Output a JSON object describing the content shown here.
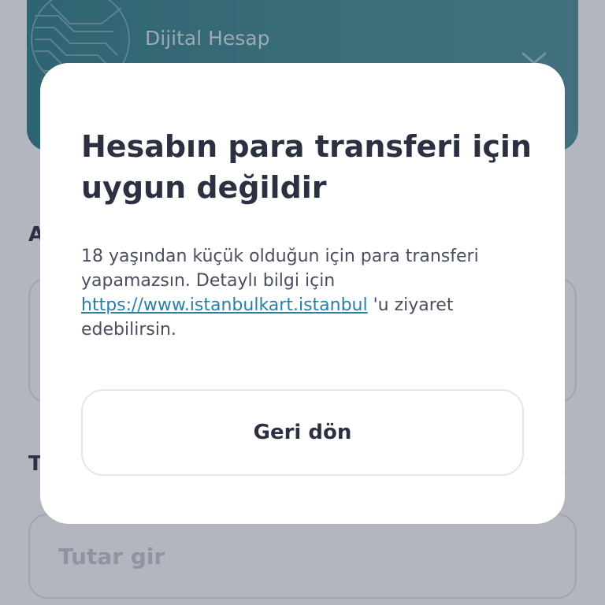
{
  "card": {
    "label": "Dijital Hesap"
  },
  "background": {
    "section_a_heading": "A",
    "section_t_heading": "T",
    "section_t_link": ")",
    "amount_input": {
      "value": "",
      "placeholder": "Tutar gir"
    }
  },
  "modal": {
    "title": "Hesabın para transferi için uygun değildir",
    "body_before_link": "18 yaşından küçük olduğun için para transferi yapamazsın. Detaylı bilgi için ",
    "link_text": "https://www.istanbulkart.istanbul",
    "body_after_link": " 'u ziyaret edebilirsin.",
    "back_button_label": "Geri dön"
  },
  "colors": {
    "card_teal": "#3f8b92",
    "title_text": "#2b3140",
    "link": "#2a7fa8",
    "scrim": "#30364e"
  }
}
